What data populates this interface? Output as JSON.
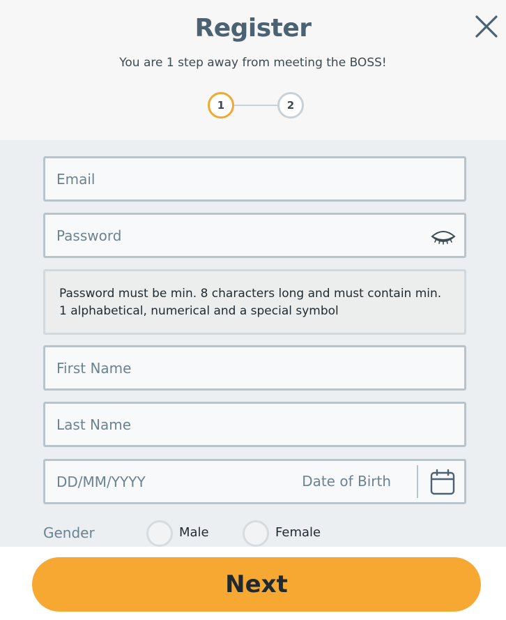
{
  "header": {
    "title": "Register",
    "subtitle": "You are 1 step away from meeting the BOSS!",
    "close_icon": "close-icon"
  },
  "stepper": {
    "steps": [
      {
        "label": "1",
        "active": true
      },
      {
        "label": "2",
        "active": false
      }
    ]
  },
  "form": {
    "email": {
      "placeholder": "Email",
      "value": ""
    },
    "password": {
      "placeholder": "Password",
      "value": "",
      "toggle_icon": "eye-icon"
    },
    "password_hint": "Password must be min. 8 characters long and must contain min. 1 alphabetical, numerical and a special symbol",
    "first_name": {
      "placeholder": "First Name",
      "value": ""
    },
    "last_name": {
      "placeholder": "Last Name",
      "value": ""
    },
    "dob": {
      "placeholder": "DD/MM/YYYY",
      "label": "Date of Birth",
      "value": "",
      "icon": "calendar-icon"
    },
    "gender": {
      "label": "Gender",
      "options": [
        {
          "label": "Male",
          "selected": false
        },
        {
          "label": "Female",
          "selected": false
        }
      ]
    }
  },
  "actions": {
    "next_label": "Next"
  },
  "colors": {
    "accent": "#f7a833",
    "step_active_border": "#f0a830",
    "title": "#4a6272",
    "form_background": "#ebeff2"
  }
}
